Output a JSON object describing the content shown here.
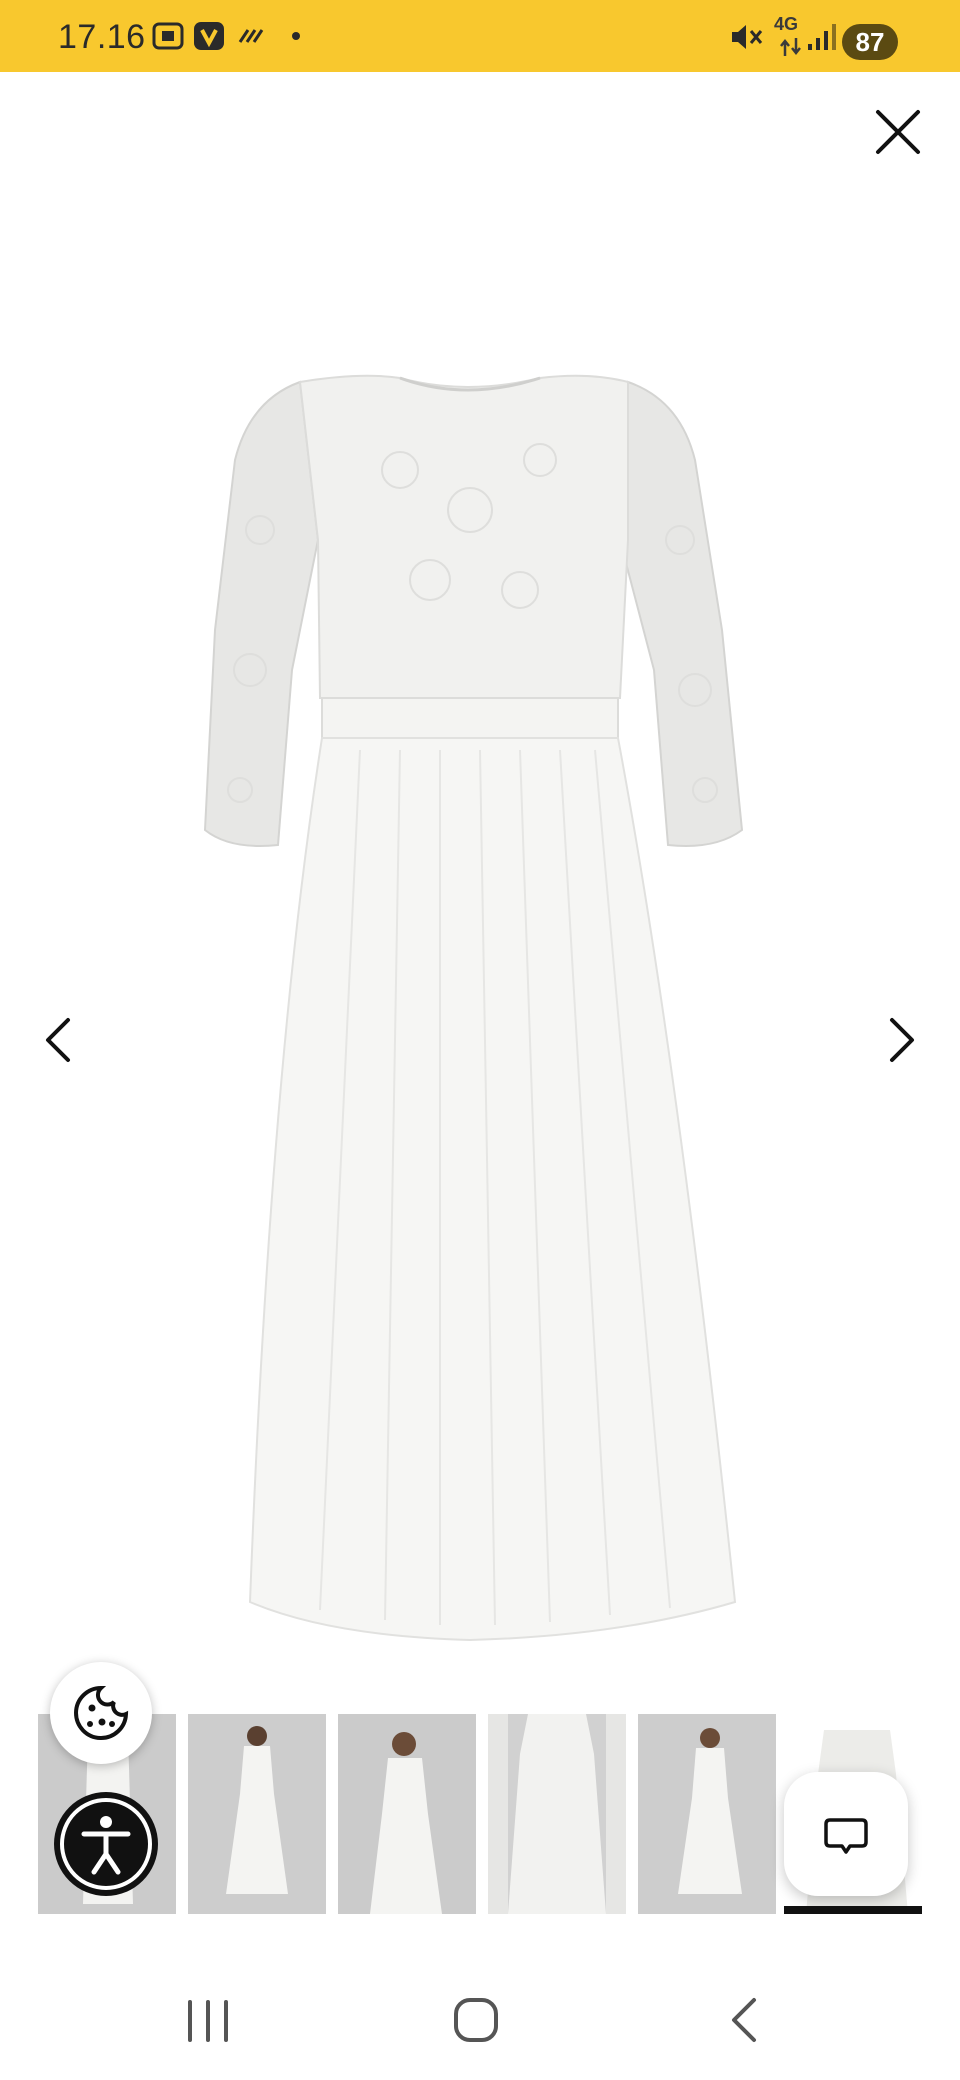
{
  "status_bar": {
    "time": "17.16",
    "network": "4G",
    "battery": "87",
    "background": "#f8c82e"
  },
  "icons": {
    "close": "close-icon",
    "prev": "chevron-left-icon",
    "next": "chevron-right-icon",
    "cookie": "cookie-icon",
    "accessibility": "accessibility-icon",
    "chat": "chat-icon"
  },
  "gallery": {
    "thumbnail_count": 6,
    "selected_thumbnail": 6
  },
  "system_nav": {
    "recents": "recents-icon",
    "home": "home-icon",
    "back": "back-icon"
  }
}
